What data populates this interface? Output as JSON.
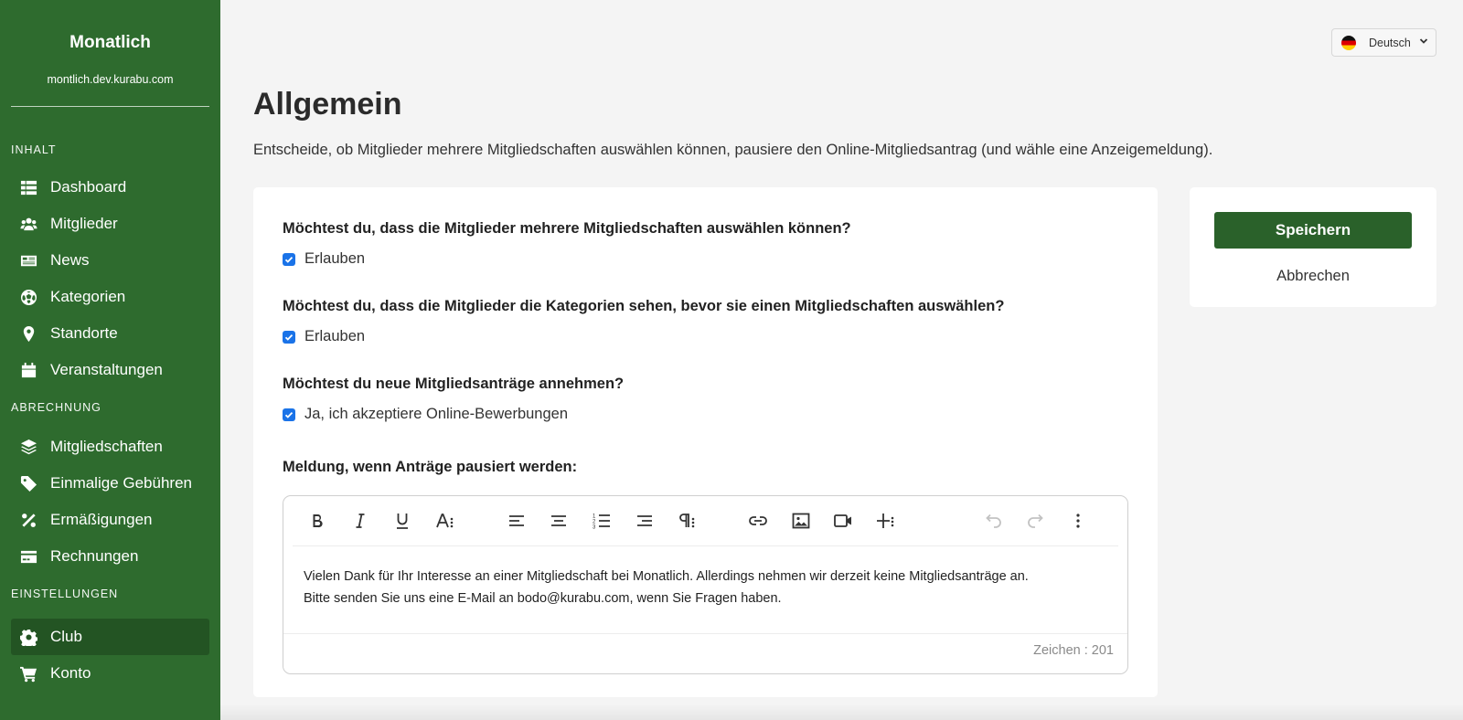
{
  "sidebar": {
    "club_name": "Monatlich",
    "club_url": "montlich.dev.kurabu.com",
    "sections": {
      "content": "INHALT",
      "billing": "ABRECHNUNG",
      "settings": "EINSTELLUNGEN"
    },
    "items": {
      "dashboard": {
        "label": "Dashboard",
        "icon": "table-icon"
      },
      "members": {
        "label": "Mitglieder",
        "icon": "users-icon"
      },
      "news": {
        "label": "News",
        "icon": "newspaper-icon"
      },
      "categories": {
        "label": "Kategorien",
        "icon": "soccer-ball-icon"
      },
      "locations": {
        "label": "Standorte",
        "icon": "map-pin-icon"
      },
      "events": {
        "label": "Veranstaltungen",
        "icon": "calendar-icon"
      },
      "memberships": {
        "label": "Mitgliedschaften",
        "icon": "layers-icon"
      },
      "one_time_fees": {
        "label": "Einmalige Gebühren",
        "icon": "tag-icon"
      },
      "discounts": {
        "label": "Ermäßigungen",
        "icon": "percent-icon"
      },
      "invoices": {
        "label": "Rechnungen",
        "icon": "credit-card-icon"
      },
      "club": {
        "label": "Club",
        "icon": "gear-icon"
      },
      "account": {
        "label": "Konto",
        "icon": "cart-icon"
      }
    },
    "active_item": "club"
  },
  "language": {
    "selected": "Deutsch"
  },
  "main": {
    "title": "Allgemein",
    "description": "Entscheide, ob Mitglieder mehrere Mitgliedschaften auswählen können, pausiere den Online-Mitgliedsantrag (und wähle eine Anzeigemeldung).",
    "questions": [
      {
        "question": "Möchtest du, dass die Mitglieder mehrere Mitgliedschaften auswählen können?",
        "checkbox_label": "Erlauben",
        "checked": true
      },
      {
        "question": "Möchtest du, dass die Mitglieder die Kategorien sehen, bevor sie einen Mitgliedschaften auswählen?",
        "checkbox_label": "Erlauben",
        "checked": true
      },
      {
        "question": "Möchtest du neue Mitgliedsanträge annehmen?",
        "checkbox_label": "Ja, ich akzeptiere Online-Bewerbungen",
        "checked": true
      }
    ],
    "paused_message_label": "Meldung, wenn Anträge pausiert werden:",
    "editor": {
      "toolbar": [
        "bold-icon",
        "italic-icon",
        "underline-icon",
        "font-size-icon",
        "align-left-icon",
        "align-center-icon",
        "ordered-list-icon",
        "align-right-icon",
        "paragraph-icon",
        "link-icon",
        "image-icon",
        "video-icon",
        "insert-icon",
        "undo-icon",
        "redo-icon",
        "more-icon"
      ],
      "text_line1": "Vielen Dank für Ihr Interesse an einer Mitgliedschaft bei Monatlich. Allerdings nehmen wir derzeit keine Mitgliedsanträge an.",
      "text_line2": "Bitte senden Sie uns eine E-Mail an bodo@kurabu.com, wenn Sie Fragen haben.",
      "char_count": "Zeichen : 201"
    }
  },
  "actions": {
    "save": "Speichern",
    "cancel": "Abbrechen"
  },
  "colors": {
    "sidebar": "#2e6b2e",
    "sidebar_active": "#235423",
    "primary_button": "#2a612a",
    "checkbox": "#1a73e8"
  }
}
